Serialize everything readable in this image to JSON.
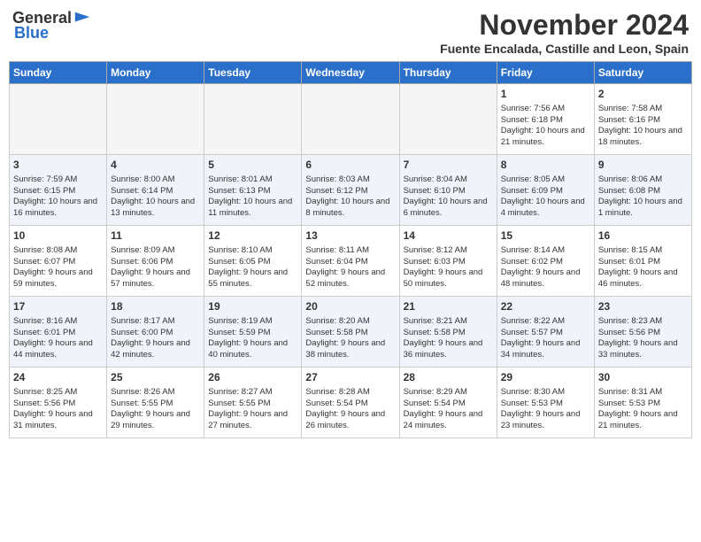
{
  "header": {
    "logo_general": "General",
    "logo_blue": "Blue",
    "month": "November 2024",
    "location": "Fuente Encalada, Castille and Leon, Spain"
  },
  "days_of_week": [
    "Sunday",
    "Monday",
    "Tuesday",
    "Wednesday",
    "Thursday",
    "Friday",
    "Saturday"
  ],
  "weeks": [
    [
      {
        "day": "",
        "empty": true
      },
      {
        "day": "",
        "empty": true
      },
      {
        "day": "",
        "empty": true
      },
      {
        "day": "",
        "empty": true
      },
      {
        "day": "",
        "empty": true
      },
      {
        "day": "1",
        "sunrise": "Sunrise: 7:56 AM",
        "sunset": "Sunset: 6:18 PM",
        "daylight": "Daylight: 10 hours and 21 minutes."
      },
      {
        "day": "2",
        "sunrise": "Sunrise: 7:58 AM",
        "sunset": "Sunset: 6:16 PM",
        "daylight": "Daylight: 10 hours and 18 minutes."
      }
    ],
    [
      {
        "day": "3",
        "sunrise": "Sunrise: 7:59 AM",
        "sunset": "Sunset: 6:15 PM",
        "daylight": "Daylight: 10 hours and 16 minutes."
      },
      {
        "day": "4",
        "sunrise": "Sunrise: 8:00 AM",
        "sunset": "Sunset: 6:14 PM",
        "daylight": "Daylight: 10 hours and 13 minutes."
      },
      {
        "day": "5",
        "sunrise": "Sunrise: 8:01 AM",
        "sunset": "Sunset: 6:13 PM",
        "daylight": "Daylight: 10 hours and 11 minutes."
      },
      {
        "day": "6",
        "sunrise": "Sunrise: 8:03 AM",
        "sunset": "Sunset: 6:12 PM",
        "daylight": "Daylight: 10 hours and 8 minutes."
      },
      {
        "day": "7",
        "sunrise": "Sunrise: 8:04 AM",
        "sunset": "Sunset: 6:10 PM",
        "daylight": "Daylight: 10 hours and 6 minutes."
      },
      {
        "day": "8",
        "sunrise": "Sunrise: 8:05 AM",
        "sunset": "Sunset: 6:09 PM",
        "daylight": "Daylight: 10 hours and 4 minutes."
      },
      {
        "day": "9",
        "sunrise": "Sunrise: 8:06 AM",
        "sunset": "Sunset: 6:08 PM",
        "daylight": "Daylight: 10 hours and 1 minute."
      }
    ],
    [
      {
        "day": "10",
        "sunrise": "Sunrise: 8:08 AM",
        "sunset": "Sunset: 6:07 PM",
        "daylight": "Daylight: 9 hours and 59 minutes."
      },
      {
        "day": "11",
        "sunrise": "Sunrise: 8:09 AM",
        "sunset": "Sunset: 6:06 PM",
        "daylight": "Daylight: 9 hours and 57 minutes."
      },
      {
        "day": "12",
        "sunrise": "Sunrise: 8:10 AM",
        "sunset": "Sunset: 6:05 PM",
        "daylight": "Daylight: 9 hours and 55 minutes."
      },
      {
        "day": "13",
        "sunrise": "Sunrise: 8:11 AM",
        "sunset": "Sunset: 6:04 PM",
        "daylight": "Daylight: 9 hours and 52 minutes."
      },
      {
        "day": "14",
        "sunrise": "Sunrise: 8:12 AM",
        "sunset": "Sunset: 6:03 PM",
        "daylight": "Daylight: 9 hours and 50 minutes."
      },
      {
        "day": "15",
        "sunrise": "Sunrise: 8:14 AM",
        "sunset": "Sunset: 6:02 PM",
        "daylight": "Daylight: 9 hours and 48 minutes."
      },
      {
        "day": "16",
        "sunrise": "Sunrise: 8:15 AM",
        "sunset": "Sunset: 6:01 PM",
        "daylight": "Daylight: 9 hours and 46 minutes."
      }
    ],
    [
      {
        "day": "17",
        "sunrise": "Sunrise: 8:16 AM",
        "sunset": "Sunset: 6:01 PM",
        "daylight": "Daylight: 9 hours and 44 minutes."
      },
      {
        "day": "18",
        "sunrise": "Sunrise: 8:17 AM",
        "sunset": "Sunset: 6:00 PM",
        "daylight": "Daylight: 9 hours and 42 minutes."
      },
      {
        "day": "19",
        "sunrise": "Sunrise: 8:19 AM",
        "sunset": "Sunset: 5:59 PM",
        "daylight": "Daylight: 9 hours and 40 minutes."
      },
      {
        "day": "20",
        "sunrise": "Sunrise: 8:20 AM",
        "sunset": "Sunset: 5:58 PM",
        "daylight": "Daylight: 9 hours and 38 minutes."
      },
      {
        "day": "21",
        "sunrise": "Sunrise: 8:21 AM",
        "sunset": "Sunset: 5:58 PM",
        "daylight": "Daylight: 9 hours and 36 minutes."
      },
      {
        "day": "22",
        "sunrise": "Sunrise: 8:22 AM",
        "sunset": "Sunset: 5:57 PM",
        "daylight": "Daylight: 9 hours and 34 minutes."
      },
      {
        "day": "23",
        "sunrise": "Sunrise: 8:23 AM",
        "sunset": "Sunset: 5:56 PM",
        "daylight": "Daylight: 9 hours and 33 minutes."
      }
    ],
    [
      {
        "day": "24",
        "sunrise": "Sunrise: 8:25 AM",
        "sunset": "Sunset: 5:56 PM",
        "daylight": "Daylight: 9 hours and 31 minutes."
      },
      {
        "day": "25",
        "sunrise": "Sunrise: 8:26 AM",
        "sunset": "Sunset: 5:55 PM",
        "daylight": "Daylight: 9 hours and 29 minutes."
      },
      {
        "day": "26",
        "sunrise": "Sunrise: 8:27 AM",
        "sunset": "Sunset: 5:55 PM",
        "daylight": "Daylight: 9 hours and 27 minutes."
      },
      {
        "day": "27",
        "sunrise": "Sunrise: 8:28 AM",
        "sunset": "Sunset: 5:54 PM",
        "daylight": "Daylight: 9 hours and 26 minutes."
      },
      {
        "day": "28",
        "sunrise": "Sunrise: 8:29 AM",
        "sunset": "Sunset: 5:54 PM",
        "daylight": "Daylight: 9 hours and 24 minutes."
      },
      {
        "day": "29",
        "sunrise": "Sunrise: 8:30 AM",
        "sunset": "Sunset: 5:53 PM",
        "daylight": "Daylight: 9 hours and 23 minutes."
      },
      {
        "day": "30",
        "sunrise": "Sunrise: 8:31 AM",
        "sunset": "Sunset: 5:53 PM",
        "daylight": "Daylight: 9 hours and 21 minutes."
      }
    ]
  ]
}
